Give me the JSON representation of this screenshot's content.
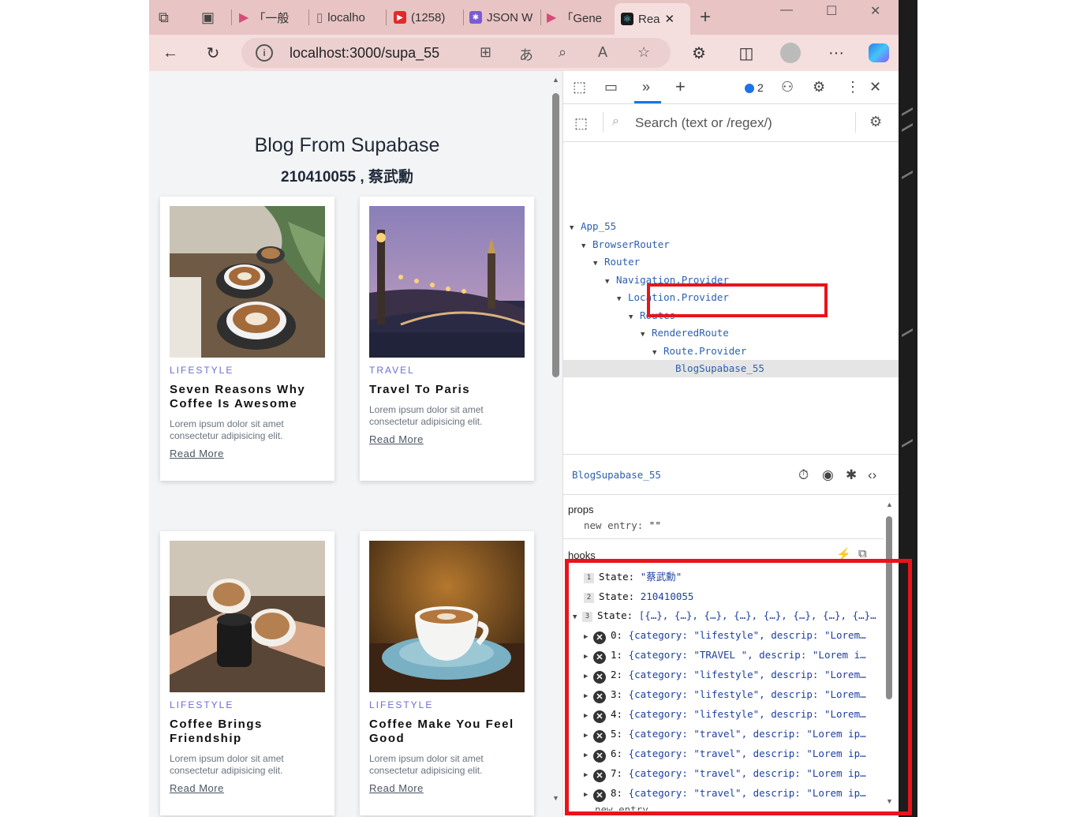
{
  "tabs": [
    {
      "label": "「一般",
      "icon": "play-icon",
      "color": "#d84b78"
    },
    {
      "label": "localho",
      "icon": "page-icon",
      "color": "#888888"
    },
    {
      "label": "(1258)",
      "icon": "youtube-icon",
      "color": "#e02b2b"
    },
    {
      "label": "JSON W",
      "icon": "json-icon",
      "color": "#7a5ad6"
    },
    {
      "label": "「Gene",
      "icon": "play-icon",
      "color": "#d84b78"
    },
    {
      "label": "Rea",
      "icon": "react-icon",
      "color": "#1b1b1b",
      "active": true
    }
  ],
  "address": {
    "url": "localhost:3000/supa_55"
  },
  "page": {
    "title": "Blog From Supabase",
    "subtitle": "210410055 , 蔡武勳",
    "cards": [
      {
        "category": "LIFESTYLE",
        "title": "Seven Reasons Why Coffee Is Awesome",
        "desc": "Lorem ipsum dolor sit amet consectetur adipisicing elit.",
        "link": "Read More"
      },
      {
        "category": "TRAVEL",
        "title": "Travel To Paris",
        "desc": "Lorem ipsum dolor sit amet consectetur adipisicing elit.",
        "link": "Read More"
      },
      {
        "category": "LIFESTYLE",
        "title": "Coffee Brings Friendship",
        "desc": "Lorem ipsum dolor sit amet consectetur adipisicing elit.",
        "link": "Read More"
      },
      {
        "category": "LIFESTYLE",
        "title": "Coffee Make You Feel Good",
        "desc": "Lorem ipsum dolor sit amet consectetur adipisicing elit.",
        "link": "Read More"
      }
    ]
  },
  "devtools": {
    "issues_count": "2",
    "search_placeholder": "Search (text or /regex/)",
    "tree": [
      {
        "name": "App_55",
        "depth": 0
      },
      {
        "name": "BrowserRouter",
        "depth": 1
      },
      {
        "name": "Router",
        "depth": 2
      },
      {
        "name": "Navigation.Provider",
        "depth": 3
      },
      {
        "name": "Location.Provider",
        "depth": 4
      },
      {
        "name": "Routes",
        "depth": 5
      },
      {
        "name": "RenderedRoute",
        "depth": 6
      },
      {
        "name": "Route.Provider",
        "depth": 7
      },
      {
        "name": "BlogSupabase_55",
        "depth": 8,
        "selected": true
      }
    ],
    "selected_component": "BlogSupabase_55",
    "props_label": "props",
    "props": {
      "key": "new entry",
      "value": "\"\""
    },
    "hooks_label": "hooks",
    "hooks": [
      {
        "n": "1",
        "label": "State:",
        "value": "\"蔡武勳\""
      },
      {
        "n": "2",
        "label": "State:",
        "value": "210410055"
      },
      {
        "n": "3",
        "label": "State:",
        "value": "[{…}, {…}, {…}, {…}, {…}, {…}, {…}, {…}…"
      }
    ],
    "entries": [
      {
        "i": "0:",
        "v": "{category: \"lifestyle\", descrip: \"Lorem…"
      },
      {
        "i": "1:",
        "v": "{category: \"TRAVEL \", descrip: \"Lorem i…"
      },
      {
        "i": "2:",
        "v": "{category: \"lifestyle\", descrip: \"Lorem…"
      },
      {
        "i": "3:",
        "v": "{category: \"lifestyle\", descrip: \"Lorem…"
      },
      {
        "i": "4:",
        "v": "{category: \"lifestyle\", descrip: \"Lorem…"
      },
      {
        "i": "5:",
        "v": "{category: \"travel\", descrip: \"Lorem ip…"
      },
      {
        "i": "6:",
        "v": "{category: \"travel\", descrip: \"Lorem ip…"
      },
      {
        "i": "7:",
        "v": "{category: \"travel\", descrip: \"Lorem ip…"
      },
      {
        "i": "8:",
        "v": "{category: \"travel\", descrip: \"Lorem ip…"
      }
    ],
    "trailing": "new entry"
  },
  "colors": {
    "highlight": "#e8141c",
    "link": "#2c5fb0",
    "accent": "#6d6bd6"
  }
}
